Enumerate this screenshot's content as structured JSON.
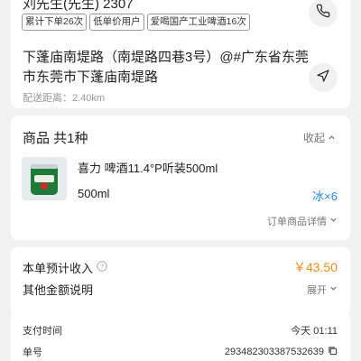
{
  "customer": {
    "name": "刘先生(先生) 2307",
    "tags": [
      "累计下单26次",
      "低单价用户",
      "爱喝国产工业啤酒16次"
    ]
  },
  "address": {
    "text": "下蓬庙南堤路（南堤路四巷3号）@#广东省东莞市东莞市下蓬庙南堤路",
    "distance": "配送距离：2.40km"
  },
  "products": {
    "title": "商品 共1种",
    "collapse_label": "收起",
    "items": [
      {
        "name": "喜力 啤酒11.4°P听装500ml",
        "spec": "500ml",
        "qty": "冰×6"
      }
    ],
    "detail_link": "订单商品详情"
  },
  "income": {
    "label": "本单预计收入",
    "value": "￥43.50",
    "other_label": "其他金额说明",
    "expand_label": "展开"
  },
  "order_info": {
    "pay_time_label": "支付时间",
    "pay_time_value": "今天 01:11",
    "order_no_label": "单号",
    "order_no_value": "2934823033875326​39"
  },
  "colors": {
    "accent_orange": "#f08a1d",
    "accent_blue": "#2a86d6",
    "muted": "#777777"
  }
}
